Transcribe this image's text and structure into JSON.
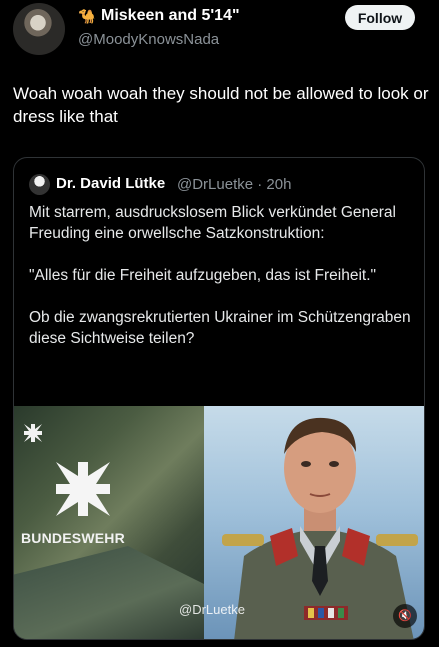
{
  "author": {
    "display_name": "Miskeen and 5'14\"",
    "handle": "@MoodyKnowsNada",
    "name_emoji": "🐪",
    "avatar": "profile-photo"
  },
  "follow_button": {
    "label": "Follow"
  },
  "tweet": {
    "text": "Woah woah woah they should not be allowed to look or dress like that"
  },
  "quoted_tweet": {
    "author_name": "Dr. David Lütke",
    "meta": "@DrLuetke · 20h",
    "paragraphs": [
      "Mit starrem, ausdruckslosem Blick verkündet General Freuding eine orwellsche Satzkonstruktion:",
      "\"Alles für die Freiheit aufzugeben, das ist Freiheit.\"",
      "Ob die zwangsrekrutierten Ukrainer im Schützengraben diese Sichtweise teilen?"
    ],
    "video": {
      "logo_text": "BUNDESWEHR",
      "watermark": "@DrLuetke",
      "mute_icon": "speaker-muted-icon"
    }
  },
  "colors": {
    "background": "#000000",
    "text_primary": "#e7e9ea",
    "text_secondary": "#8b9298",
    "border": "#2f3336",
    "follow_bg": "#eff3f4"
  }
}
